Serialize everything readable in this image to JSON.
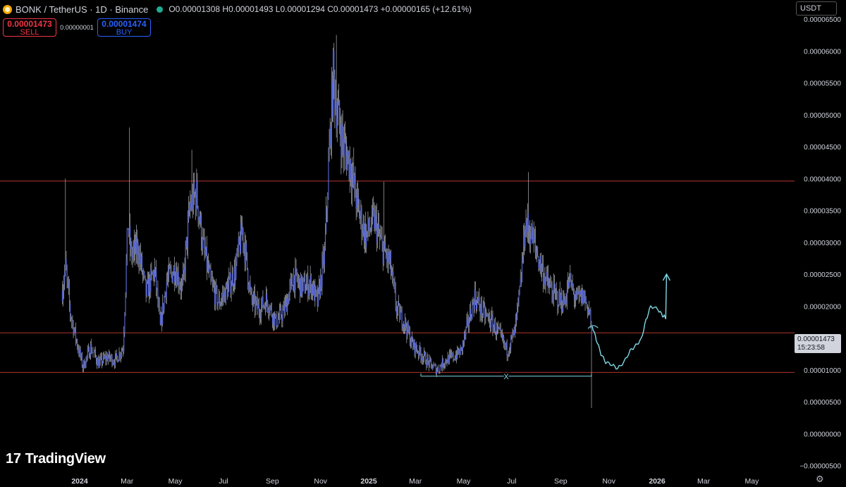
{
  "header": {
    "symbol": "BONK / TetherUS · 1D · Binance",
    "ohlc": "O0.00001308 H0.00001493 L0.00001294 C0.00001473 +0.00000165 (+12.61%)"
  },
  "trade": {
    "sell_price": "0.00001473",
    "sell_label": "SELL",
    "spread": "0.00000001",
    "buy_price": "0.00001474",
    "buy_label": "BUY"
  },
  "currency": "USDT",
  "brand": "TradingView",
  "price_tag": {
    "price": "0.00001473",
    "countdown": "15:23:58"
  },
  "colors": {
    "candle": "#5b6bd8",
    "wick": "#c9ccd6",
    "level_line": "#b2352d",
    "projection": "#7fd8e6",
    "background": "#000000"
  },
  "chart_data": {
    "type": "candlestick",
    "y_unit": "USDT",
    "y_ticks": [
      {
        "v": 6.5e-05,
        "label": "0.00006500"
      },
      {
        "v": 6e-05,
        "label": "0.00006000"
      },
      {
        "v": 5.5e-05,
        "label": "0.00005500"
      },
      {
        "v": 5e-05,
        "label": "0.00005000"
      },
      {
        "v": 4.5e-05,
        "label": "0.00004500"
      },
      {
        "v": 4e-05,
        "label": "0.00004000"
      },
      {
        "v": 3.5e-05,
        "label": "0.00003500"
      },
      {
        "v": 3e-05,
        "label": "0.00003000"
      },
      {
        "v": 2.5e-05,
        "label": "0.00002500"
      },
      {
        "v": 2e-05,
        "label": "0.00002000"
      },
      {
        "v": 1e-05,
        "label": "0.00001000"
      },
      {
        "v": 5e-06,
        "label": "0.00000500"
      },
      {
        "v": 0,
        "label": "0.00000000"
      },
      {
        "v": -5e-06,
        "label": "−0.00000500"
      }
    ],
    "x_ticks": [
      {
        "d": "2024-01-01",
        "label": "2024",
        "bold": true
      },
      {
        "d": "2024-03-01",
        "label": "Mar"
      },
      {
        "d": "2024-05-01",
        "label": "May"
      },
      {
        "d": "2024-07-01",
        "label": "Jul"
      },
      {
        "d": "2024-09-01",
        "label": "Sep"
      },
      {
        "d": "2024-11-01",
        "label": "Nov"
      },
      {
        "d": "2025-01-01",
        "label": "2025",
        "bold": true
      },
      {
        "d": "2025-03-01",
        "label": "Mar"
      },
      {
        "d": "2025-05-01",
        "label": "May"
      },
      {
        "d": "2025-07-01",
        "label": "Jul"
      },
      {
        "d": "2025-09-01",
        "label": "Sep"
      },
      {
        "d": "2025-11-01",
        "label": "Nov"
      },
      {
        "d": "2026-01-01",
        "label": "2026",
        "bold": true
      },
      {
        "d": "2026-03-01",
        "label": "Mar"
      },
      {
        "d": "2026-05-01",
        "label": "May"
      }
    ],
    "levels": [
      3.96e-05,
      1.58e-05,
      9.6e-06
    ],
    "close_path": [
      [
        "2023-12-10",
        2.25e-05
      ],
      [
        "2023-12-14",
        2.6e-05
      ],
      [
        "2023-12-20",
        1.9e-05
      ],
      [
        "2023-12-28",
        1.45e-05
      ],
      [
        "2024-01-05",
        1.05e-05
      ],
      [
        "2024-01-15",
        1.35e-05
      ],
      [
        "2024-01-25",
        1.1e-05
      ],
      [
        "2024-02-05",
        1.2e-05
      ],
      [
        "2024-02-15",
        1.15e-05
      ],
      [
        "2024-02-25",
        1.35e-05
      ],
      [
        "2024-03-02",
        3.3e-05
      ],
      [
        "2024-03-06",
        2.8e-05
      ],
      [
        "2024-03-15",
        2.9e-05
      ],
      [
        "2024-03-25",
        2.2e-05
      ],
      [
        "2024-04-05",
        2.55e-05
      ],
      [
        "2024-04-12",
        1.65e-05
      ],
      [
        "2024-04-20",
        2.4e-05
      ],
      [
        "2024-05-01",
        2.6e-05
      ],
      [
        "2024-05-10",
        2.25e-05
      ],
      [
        "2024-05-20",
        3.6e-05
      ],
      [
        "2024-05-28",
        3.75e-05
      ],
      [
        "2024-06-05",
        2.95e-05
      ],
      [
        "2024-06-15",
        2.35e-05
      ],
      [
        "2024-06-25",
        2.05e-05
      ],
      [
        "2024-07-05",
        2.25e-05
      ],
      [
        "2024-07-15",
        2.5e-05
      ],
      [
        "2024-07-25",
        3.2e-05
      ],
      [
        "2024-08-05",
        2.1e-05
      ],
      [
        "2024-08-15",
        1.95e-05
      ],
      [
        "2024-08-25",
        2.1e-05
      ],
      [
        "2024-09-05",
        1.75e-05
      ],
      [
        "2024-09-15",
        1.9e-05
      ],
      [
        "2024-09-28",
        2.45e-05
      ],
      [
        "2024-10-08",
        2.3e-05
      ],
      [
        "2024-10-20",
        2.35e-05
      ],
      [
        "2024-10-28",
        2.05e-05
      ],
      [
        "2024-11-06",
        2.8e-05
      ],
      [
        "2024-11-12",
        4.4e-05
      ],
      [
        "2024-11-17",
        5.6e-05
      ],
      [
        "2024-11-22",
        5.05e-05
      ],
      [
        "2024-11-30",
        4.5e-05
      ],
      [
        "2024-12-08",
        4.25e-05
      ],
      [
        "2024-12-18",
        3.55e-05
      ],
      [
        "2024-12-28",
        3.1e-05
      ],
      [
        "2025-01-08",
        3.35e-05
      ],
      [
        "2025-01-18",
        2.9e-05
      ],
      [
        "2025-01-28",
        2.65e-05
      ],
      [
        "2025-02-05",
        1.95e-05
      ],
      [
        "2025-02-15",
        1.75e-05
      ],
      [
        "2025-02-25",
        1.4e-05
      ],
      [
        "2025-03-08",
        1.25e-05
      ],
      [
        "2025-03-18",
        1.1e-05
      ],
      [
        "2025-03-28",
        1e-05
      ],
      [
        "2025-04-08",
        1.15e-05
      ],
      [
        "2025-04-18",
        1.2e-05
      ],
      [
        "2025-04-28",
        1.3e-05
      ],
      [
        "2025-05-08",
        1.8e-05
      ],
      [
        "2025-05-15",
        2.15e-05
      ],
      [
        "2025-05-25",
        1.9e-05
      ],
      [
        "2025-06-05",
        1.75e-05
      ],
      [
        "2025-06-15",
        1.55e-05
      ],
      [
        "2025-06-25",
        1.3e-05
      ],
      [
        "2025-07-05",
        1.6e-05
      ],
      [
        "2025-07-12",
        2.3e-05
      ],
      [
        "2025-07-18",
        3.3e-05
      ],
      [
        "2025-07-25",
        3.15e-05
      ],
      [
        "2025-08-05",
        2.7e-05
      ],
      [
        "2025-08-15",
        2.35e-05
      ],
      [
        "2025-08-25",
        2.15e-05
      ],
      [
        "2025-09-05",
        2.05e-05
      ],
      [
        "2025-09-12",
        2.4e-05
      ],
      [
        "2025-09-20",
        2.1e-05
      ],
      [
        "2025-09-30",
        2.15e-05
      ],
      [
        "2025-10-08",
        1.9e-05
      ],
      [
        "2025-10-10",
        1.47e-05
      ]
    ],
    "spikes": [
      [
        "2023-12-14",
        4e-05
      ],
      [
        "2024-03-04",
        4.8e-05
      ],
      [
        "2024-05-22",
        4.45e-05
      ],
      [
        "2024-11-21",
        6.25e-05
      ],
      [
        "2025-01-20",
        3.95e-05
      ],
      [
        "2025-07-22",
        4.1e-05
      ],
      [
        "2025-10-10",
        4e-06
      ]
    ],
    "projection_path": [
      [
        "2025-10-11",
        1.68e-05
      ],
      [
        "2025-10-16",
        1.48e-05
      ],
      [
        "2025-10-22",
        1.25e-05
      ],
      [
        "2025-10-28",
        1.12e-05
      ],
      [
        "2025-11-05",
        1.08e-05
      ],
      [
        "2025-11-12",
        1.02e-05
      ],
      [
        "2025-11-20",
        1.12e-05
      ],
      [
        "2025-11-28",
        1.3e-05
      ],
      [
        "2025-12-05",
        1.38e-05
      ],
      [
        "2025-12-12",
        1.48e-05
      ],
      [
        "2025-12-18",
        1.78e-05
      ],
      [
        "2025-12-24",
        2e-05
      ],
      [
        "2026-01-02",
        1.95e-05
      ],
      [
        "2026-01-08",
        1.85e-05
      ],
      [
        "2026-01-12",
        1.82e-05
      ],
      [
        "2026-01-13",
        2.5e-05
      ]
    ],
    "support_marker": {
      "from": "2025-03-08",
      "to": "2025-10-10",
      "value": 9e-06,
      "label": "X"
    }
  }
}
